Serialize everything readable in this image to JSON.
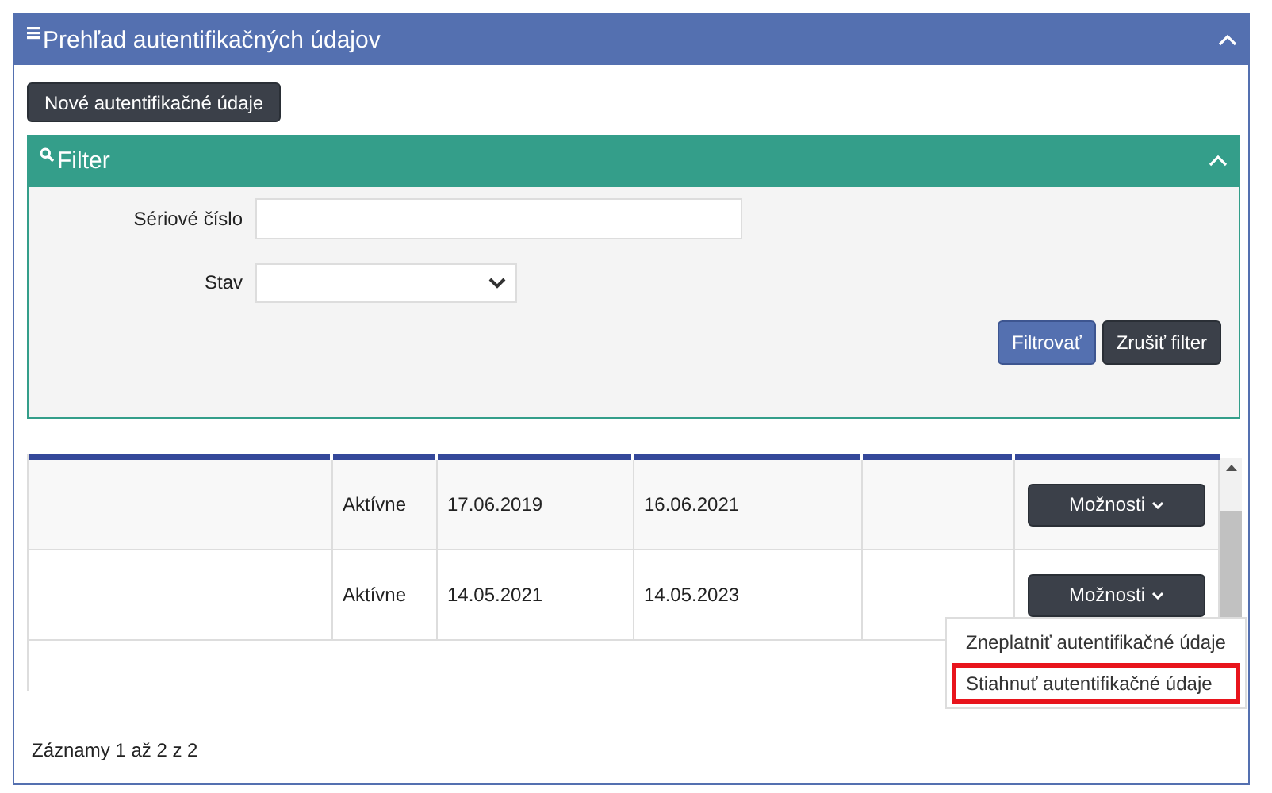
{
  "panel": {
    "title": "Prehľad autentifikačných údajov",
    "new_button": "Nové autentifikačné údaje"
  },
  "filter": {
    "title": "Filter",
    "fields": [
      {
        "kind": "text",
        "label": "Sériové číslo"
      },
      {
        "kind": "select",
        "label": "Stav"
      }
    ],
    "buttons": [
      {
        "kind": "primary",
        "label": "Filtrovať"
      },
      {
        "kind": "dark",
        "label": "Zrušiť filter"
      }
    ]
  },
  "table": {
    "rows": [
      {
        "status": "Aktívne",
        "valid_from": "17.06.2019",
        "valid_to": "16.06.2021",
        "options": "Možnosti"
      },
      {
        "status": "Aktívne",
        "valid_from": "14.05.2021",
        "valid_to": "14.05.2023",
        "options": "Možnosti",
        "menu": [
          {
            "label": "Zneplatniť autentifikačné údaje",
            "highlighted": false
          },
          {
            "label": "Stiahnuť autentifikačné údaje",
            "highlighted": true
          }
        ]
      }
    ]
  },
  "footer": "Záznamy 1 až 2 z 2"
}
